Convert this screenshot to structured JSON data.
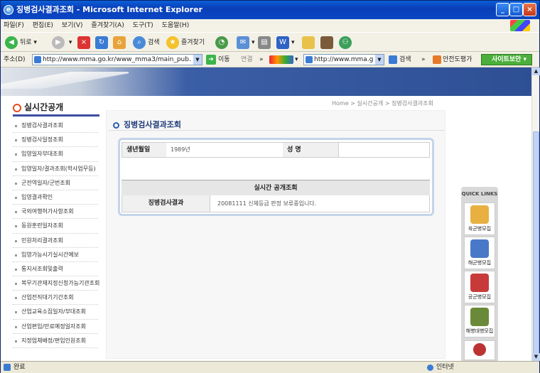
{
  "window": {
    "title": "징병검사결과조회 - Microsoft Internet Explorer",
    "controls": [
      "_",
      "□",
      "×"
    ]
  },
  "menu": [
    "파일(F)",
    "편집(E)",
    "보기(V)",
    "즐겨찾기(A)",
    "도구(T)",
    "도움말(H)"
  ],
  "toolbar": {
    "back": "뒤로",
    "search": "검색",
    "favorites": "즐겨찾기"
  },
  "address": {
    "label": "주소(D)",
    "url": "http://www.mma.go.kr/www_mma3/main_pub.",
    "go": "이동",
    "links": "연결",
    "links_chevron": "»",
    "second_url": "http://www.mma.g",
    "search": "검색",
    "chevron": "»",
    "safety": "안전도평가",
    "site_security": "사이트보안"
  },
  "sidebar": {
    "title": "실시간공개",
    "items": [
      "징병검사결과조회",
      "징병검사일정조회",
      "입영일자부대조회",
      "입영일자/결과조회(학사업무등)",
      "군전역일자/군번조회",
      "입영결과확인",
      "국외여행허가사항조회",
      "동원훈련일자조회",
      "민원처리결과조회",
      "입영가능시기실시간예보",
      "통지서조회및출력",
      "복무기관재지정신청가능기관조회",
      "산업전직대기기간조회",
      "산업교육소집일자/부대조회",
      "산업편입/만료예정일자조회",
      "지정업체배정/편입인원조회"
    ]
  },
  "breadcrumb": "Home > 실시간공개 > 징병검사결과조회",
  "main": {
    "title": "징병검사결과조회",
    "birth_label": "생년월일",
    "birth_value": "1989년",
    "name_label": "성 명",
    "name_value": "",
    "realtime_header": "실시간 공개조회",
    "result_label": "징병검사결과",
    "result_value": "20081111 신체등급 판정 보류중입니다."
  },
  "quick_links": {
    "title": "QUICK LINKS",
    "items": [
      "육군병모집",
      "해군병모집",
      "공군병모집",
      "해병대병모집"
    ]
  },
  "status": {
    "left": "완료",
    "zone": "인터넷"
  },
  "colors": {
    "titlebar": "#0a5fd8",
    "accent": "#1f3a7a",
    "sidebar_rule": "#3c4ea0"
  }
}
